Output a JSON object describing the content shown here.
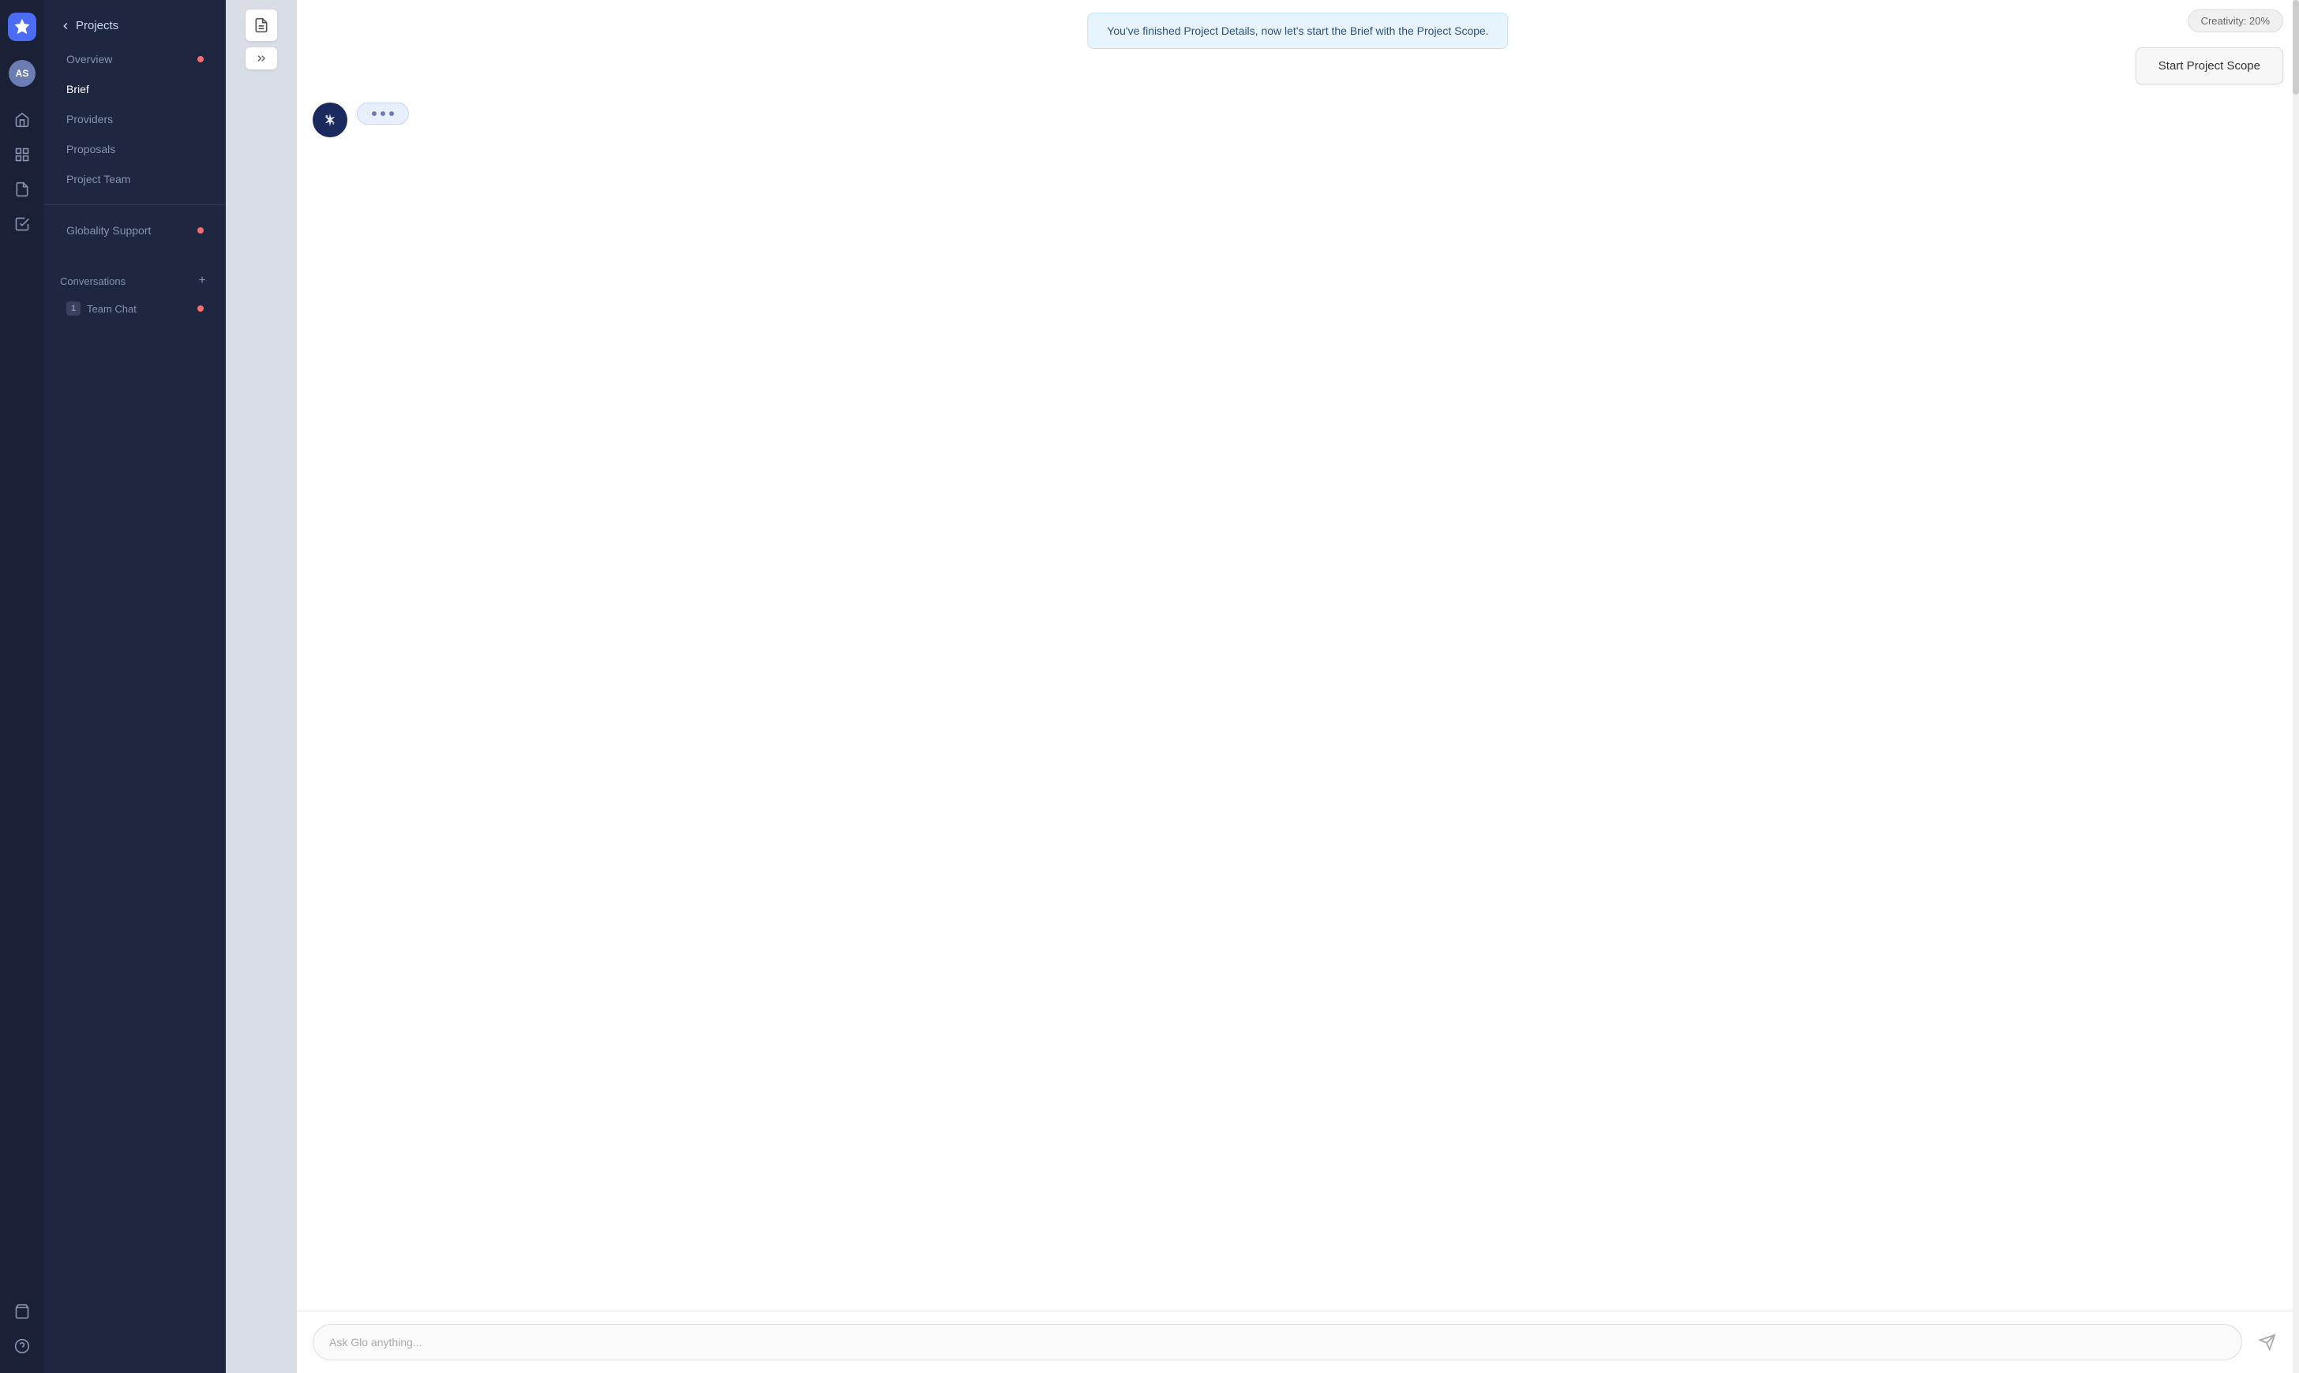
{
  "rail": {
    "logo_aria": "Globality logo",
    "avatar_initials": "AS",
    "icons": [
      {
        "name": "home-icon",
        "symbol": "⌂",
        "active": false
      },
      {
        "name": "tasks-icon",
        "symbol": "⊞",
        "active": false
      },
      {
        "name": "clipboard-icon",
        "symbol": "📋",
        "active": false
      },
      {
        "name": "check-icon",
        "symbol": "✓",
        "active": false
      },
      {
        "name": "bag-icon",
        "symbol": "💼",
        "active": false
      },
      {
        "name": "help-icon",
        "symbol": "?",
        "active": false
      }
    ]
  },
  "sidebar": {
    "back_label": "Projects",
    "items": [
      {
        "label": "Overview",
        "has_dot": true,
        "active": false
      },
      {
        "label": "Brief",
        "has_dot": false,
        "active": true
      },
      {
        "label": "Providers",
        "has_dot": false,
        "active": false
      },
      {
        "label": "Proposals",
        "has_dot": false,
        "active": false
      },
      {
        "label": "Project Team",
        "has_dot": false,
        "active": false
      }
    ],
    "globality_support": {
      "label": "Globality Support",
      "has_dot": true
    },
    "conversations_label": "Conversations",
    "add_button_label": "+",
    "team_chat": {
      "num": "1",
      "label": "Team Chat",
      "has_dot": true
    }
  },
  "notification": {
    "text": "You've finished Project Details, now let's start the Brief with the Project Scope."
  },
  "toolbar": {
    "creativity_label": "Creativity: 20%",
    "start_scope_label": "Start Project Scope"
  },
  "chat": {
    "ellipsis_aria": "typing indicator"
  },
  "input": {
    "placeholder": "Ask Glo anything..."
  }
}
